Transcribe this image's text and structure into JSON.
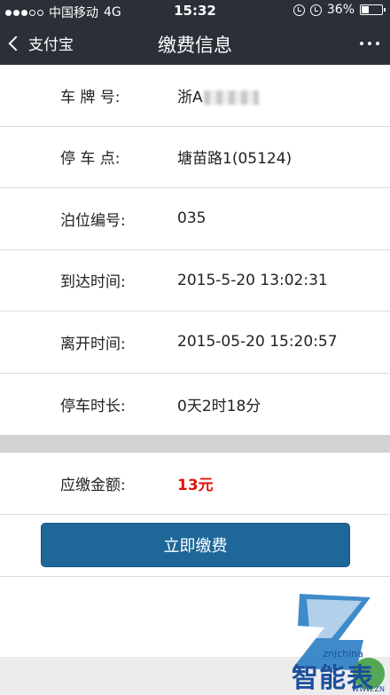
{
  "status_bar": {
    "carrier": "中国移动",
    "network": "4G",
    "time": "15:32",
    "battery": "36%"
  },
  "nav": {
    "back_label": "支付宝",
    "title": "缴费信息"
  },
  "details": [
    {
      "label": "车 牌 号:",
      "value": "浙A"
    },
    {
      "label": "停 车 点:",
      "value": "塘苗路1(05124)"
    },
    {
      "label": "泊位编号:",
      "value": "035"
    },
    {
      "label": "到达时间:",
      "value": "2015-5-20 13:02:31"
    },
    {
      "label": "离开时间:",
      "value": "2015-05-20 15:20:57"
    },
    {
      "label": "停车时长:",
      "value": "0天2时18分"
    }
  ],
  "amount": {
    "label": "应缴金额:",
    "value": "13元",
    "color": "#e1140a"
  },
  "pay_button": {
    "label": "立即缴费",
    "color": "#1f6799"
  },
  "watermark": {
    "text": "智能表",
    "sub": "znjchina",
    "site": "WWW.ZN"
  },
  "colors": {
    "header_bg": "#2b2f38",
    "divider": "#d2d2d2"
  }
}
